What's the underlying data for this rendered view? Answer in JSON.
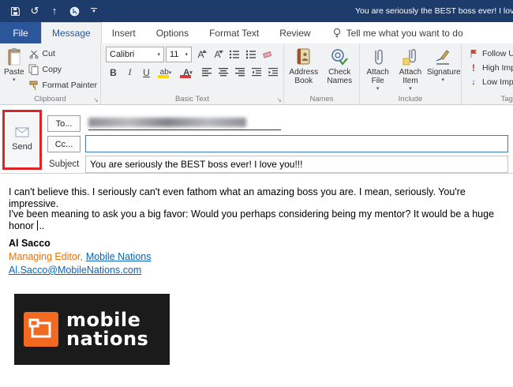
{
  "window": {
    "title": "You are seriously the BEST boss ever! I love you!!!"
  },
  "icons": {
    "caret": "▾",
    "launcher": "↘",
    "undo": "↺",
    "up_arrow": "↑"
  },
  "tabs": {
    "file": "File",
    "items": [
      "Message",
      "Insert",
      "Options",
      "Format Text",
      "Review"
    ],
    "tellme": "Tell me what you want to do"
  },
  "ribbon": {
    "clipboard": {
      "group": "Clipboard",
      "paste": "Paste",
      "cut": "Cut",
      "copy": "Copy",
      "format_painter": "Format Painter"
    },
    "basic_text": {
      "group": "Basic Text",
      "font_name": "Calibri",
      "font_size": "11",
      "bold": "B",
      "italic": "I",
      "underline": "U",
      "grow": "A",
      "shrink": "A",
      "highlight": "ab",
      "font_color": "A"
    },
    "names": {
      "group": "Names",
      "address_book": "Address Book",
      "check_names": "Check Names"
    },
    "include": {
      "group": "Include",
      "attach_file": "Attach File",
      "attach_item": "Attach Item",
      "signature": "Signature"
    },
    "tags": {
      "group": "Tags",
      "follow_up": "Follow Up",
      "high_importance": "High Importance",
      "low_importance": "Low Importance",
      "high_icon": "!",
      "low_icon": "↓"
    }
  },
  "compose": {
    "send": "Send",
    "to": "To...",
    "cc": "Cc...",
    "subject_label": "Subject",
    "subject": "You are seriously the BEST boss ever! I love you!!!"
  },
  "message": {
    "p1": "I can't believe this. I seriously can't even fathom what an amazing boss you are. I mean, seriously. You're impressive.",
    "p2": "I've been meaning to ask you a big favor: Would you perhaps considering being my mentor? It would be a huge honor ",
    "p2_after": "..",
    "sig_name": "Al Sacco",
    "sig_role": "Managing Editor,",
    "sig_org": "Mobile Nations",
    "sig_email": "Al.Sacco@MobileNations.com"
  },
  "logo": {
    "line1": "mobile",
    "line2": "nations"
  },
  "colors": {
    "titlebar": "#1e3c6b",
    "accent": "#2b579a",
    "annotation": "#e32227",
    "link": "#0563c1",
    "orange_text": "#e8720c",
    "logo_orange": "#f26a21"
  }
}
